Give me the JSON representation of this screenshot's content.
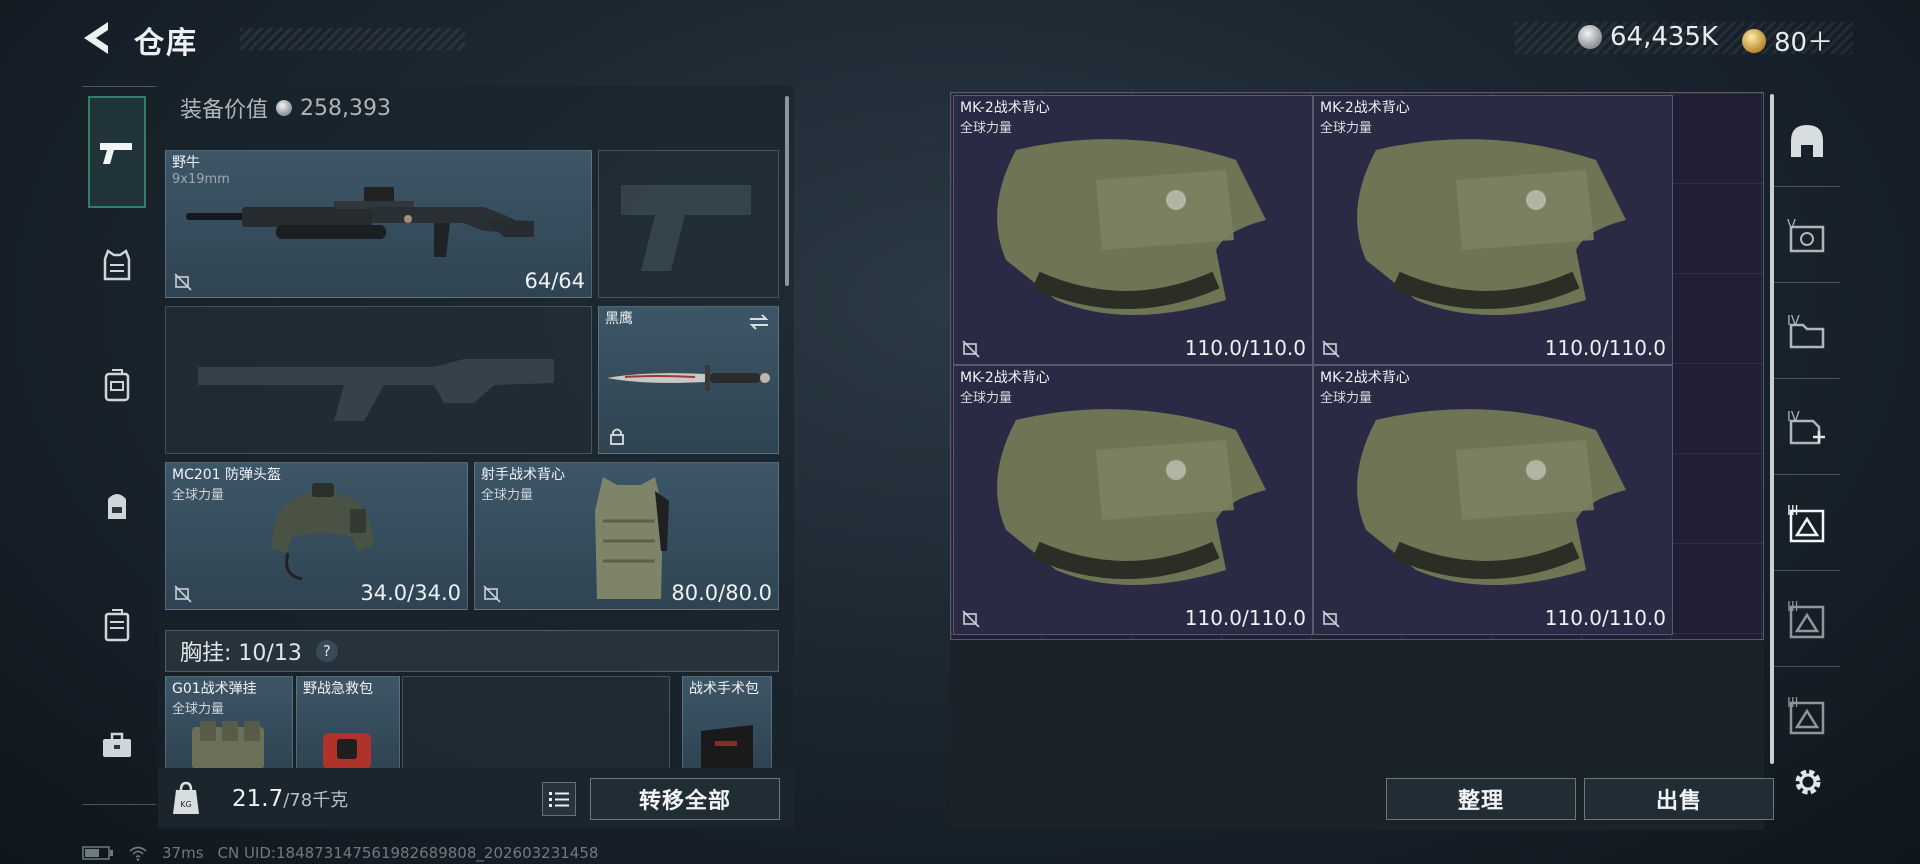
{
  "header": {
    "title": "仓库",
    "currencies": [
      {
        "icon": "silver-coin-icon",
        "value": "64,435K"
      },
      {
        "icon": "gold-coin-icon",
        "value": "80＋"
      }
    ]
  },
  "left_nav": {
    "items": [
      {
        "name": "firearms-tab",
        "icon": "pistol-icon",
        "active": true
      },
      {
        "name": "armor-tab",
        "icon": "vest-icon"
      },
      {
        "name": "chest-rig-tab",
        "icon": "chest-rig-icon"
      },
      {
        "name": "backpack-tab",
        "icon": "backpack-icon"
      },
      {
        "name": "container-tab",
        "icon": "case-icon"
      },
      {
        "name": "toolbox-tab",
        "icon": "toolbox-icon"
      }
    ]
  },
  "loadout": {
    "equip_value_label": "装备价值",
    "equip_value": "258,393",
    "primary_weapon": {
      "name": "野牛",
      "caliber": "9x19mm",
      "ammo": "64/64"
    },
    "melee": {
      "name": "黑鹰"
    },
    "helmet": {
      "name": "MC201 防弹头盔",
      "faction": "全球力量",
      "durability": "34.0/34.0"
    },
    "armor": {
      "name": "射手战术背心",
      "faction": "全球力量",
      "durability": "80.0/80.0"
    },
    "chest_rig": {
      "label": "胸挂:",
      "capacity": "10/13",
      "help": "?"
    },
    "rig_items": [
      {
        "name": "G01战术弹挂",
        "faction": "全球力量"
      },
      {
        "name": "野战急救包"
      },
      {
        "name": "战术手术包"
      }
    ],
    "weight": "21.7",
    "weight_max": "/78千克",
    "transfer_all": "转移全部"
  },
  "stash": {
    "items": [
      {
        "name": "MK-2战术背心",
        "faction": "全球力量",
        "durability": "110.0/110.0"
      },
      {
        "name": "MK-2战术背心",
        "faction": "全球力量",
        "durability": "110.0/110.0"
      },
      {
        "name": "MK-2战术背心",
        "faction": "全球力量",
        "durability": "110.0/110.0"
      },
      {
        "name": "MK-2战术背心",
        "faction": "全球力量",
        "durability": "110.0/110.0"
      }
    ],
    "organize": "整理",
    "sell": "出售"
  },
  "right_rail": {
    "items": [
      {
        "icon": "helmet-filter-icon"
      },
      {
        "icon": "level-v-armor-icon",
        "label": "V"
      },
      {
        "icon": "level-iv-folder-icon",
        "label": "IV"
      },
      {
        "icon": "level-iv-add-icon",
        "label": "IV"
      },
      {
        "icon": "level-iii-armor-icon",
        "label": "III",
        "active": true
      },
      {
        "icon": "level-iii-armor-icon",
        "label": "III"
      },
      {
        "icon": "level-iii-armor-icon",
        "label": "III"
      }
    ],
    "settings_icon": "gear-icon"
  },
  "status": {
    "ping": "37ms",
    "uid": "CN UID:184873147561982689808_202603231458"
  }
}
